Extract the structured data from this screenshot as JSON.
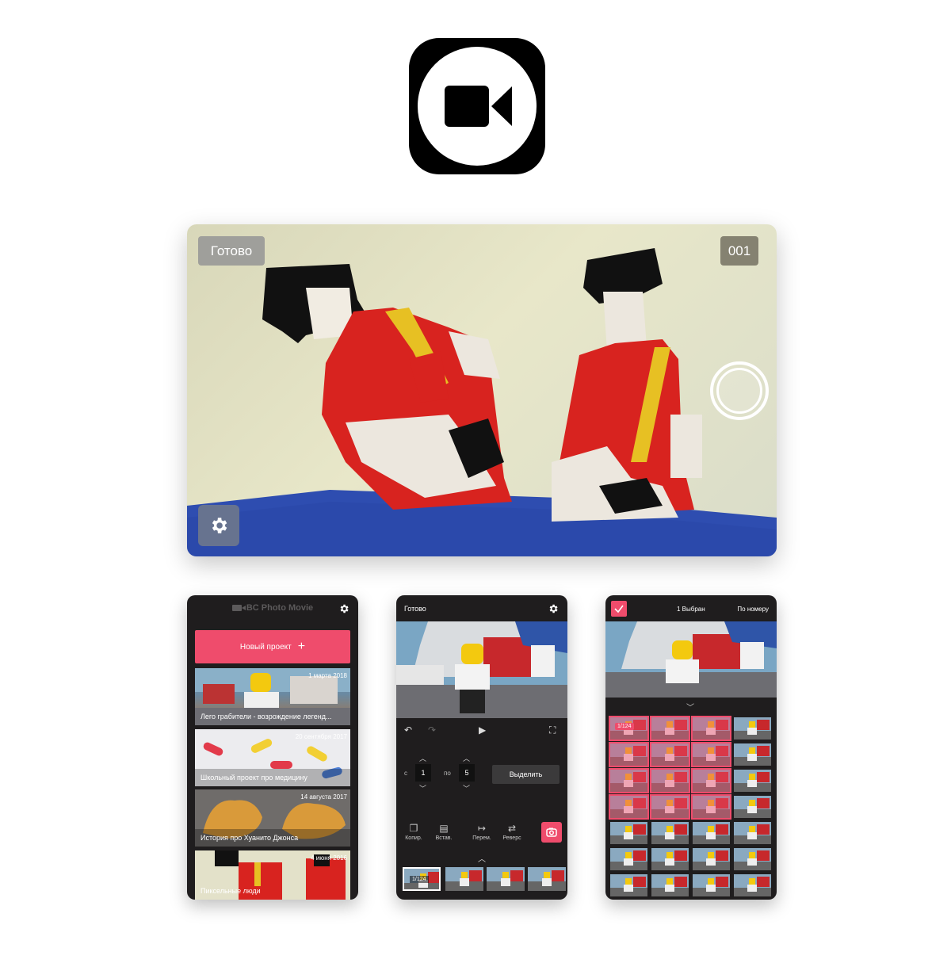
{
  "hero": {
    "done_label": "Готово",
    "frame_counter": "001"
  },
  "phone_projects": {
    "title": "BC Photo Movie",
    "new_project_label": "Новый проект",
    "projects": [
      {
        "date": "1 марта 2018",
        "name": "Лего грабители - возрождение легенд..."
      },
      {
        "date": "20 сентября 2017",
        "name": "Школьный проект про медицину"
      },
      {
        "date": "14 августа 2017",
        "name": "История про Хуанито Джонса"
      },
      {
        "date": "4 июня 2016",
        "name": "Пиксельные люди"
      }
    ]
  },
  "phone_editor": {
    "done_label": "Готово",
    "from_label": "с",
    "to_label": "по",
    "from_value": "1",
    "to_value": "5",
    "select_label": "Выделить",
    "tools": [
      {
        "icon": "copy-icon",
        "label": "Копир."
      },
      {
        "icon": "paste-icon",
        "label": "Встав."
      },
      {
        "icon": "move-icon",
        "label": "Перем."
      },
      {
        "icon": "reverse-icon",
        "label": "Реверс"
      }
    ],
    "frame_label": "1/124"
  },
  "phone_select": {
    "selected_count": "1 Выбран",
    "sort_label": "По номеру",
    "first_cell_label": "1/124"
  },
  "colors": {
    "accent": "#ef4c6c",
    "panel_bg": "#1f1d1e"
  }
}
